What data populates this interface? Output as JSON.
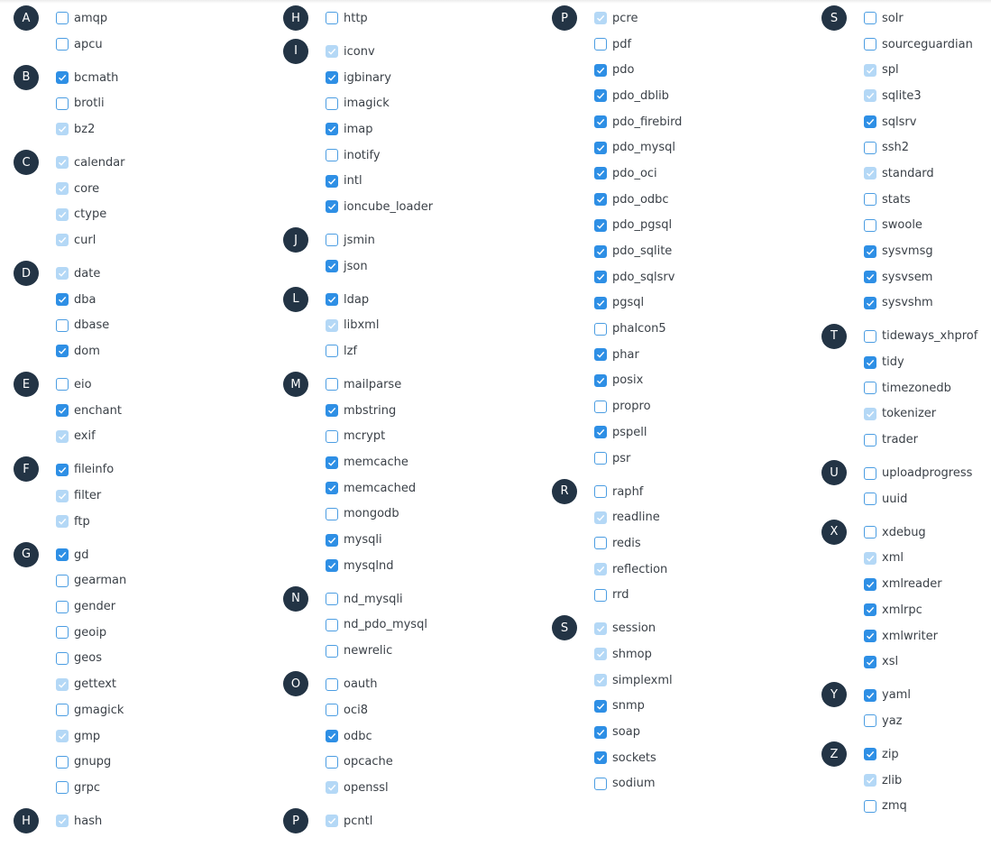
{
  "colors": {
    "badge": "#233445",
    "checked": "#2e8fe5",
    "disabled_checked": "#b4d8f6",
    "unchecked_border": "#4b9de2"
  },
  "state_legend": {
    "0": "unchecked",
    "1": "checked",
    "2": "checked-disabled"
  },
  "columns": [
    [
      {
        "letter": "A",
        "items": [
          [
            "amqp",
            0
          ],
          [
            "apcu",
            0
          ]
        ]
      },
      {
        "letter": "B",
        "items": [
          [
            "bcmath",
            1
          ],
          [
            "brotli",
            0
          ],
          [
            "bz2",
            2
          ]
        ]
      },
      {
        "letter": "C",
        "items": [
          [
            "calendar",
            2
          ],
          [
            "core",
            2
          ],
          [
            "ctype",
            2
          ],
          [
            "curl",
            2
          ]
        ]
      },
      {
        "letter": "D",
        "items": [
          [
            "date",
            2
          ],
          [
            "dba",
            1
          ],
          [
            "dbase",
            0
          ],
          [
            "dom",
            1
          ]
        ]
      },
      {
        "letter": "E",
        "items": [
          [
            "eio",
            0
          ],
          [
            "enchant",
            1
          ],
          [
            "exif",
            2
          ]
        ]
      },
      {
        "letter": "F",
        "items": [
          [
            "fileinfo",
            1
          ],
          [
            "filter",
            2
          ],
          [
            "ftp",
            2
          ]
        ]
      },
      {
        "letter": "G",
        "items": [
          [
            "gd",
            1
          ],
          [
            "gearman",
            0
          ],
          [
            "gender",
            0
          ],
          [
            "geoip",
            0
          ],
          [
            "geos",
            0
          ],
          [
            "gettext",
            2
          ],
          [
            "gmagick",
            0
          ],
          [
            "gmp",
            2
          ],
          [
            "gnupg",
            0
          ],
          [
            "grpc",
            0
          ]
        ]
      },
      {
        "letter": "H",
        "items": [
          [
            "hash",
            2
          ]
        ]
      }
    ],
    [
      {
        "letter": "H",
        "items": [
          [
            "http",
            0
          ]
        ]
      },
      {
        "letter": "I",
        "items": [
          [
            "iconv",
            2
          ],
          [
            "igbinary",
            1
          ],
          [
            "imagick",
            0
          ],
          [
            "imap",
            1
          ],
          [
            "inotify",
            0
          ],
          [
            "intl",
            1
          ],
          [
            "ioncube_loader",
            1
          ]
        ]
      },
      {
        "letter": "J",
        "items": [
          [
            "jsmin",
            0
          ],
          [
            "json",
            1
          ]
        ]
      },
      {
        "letter": "L",
        "items": [
          [
            "ldap",
            1
          ],
          [
            "libxml",
            2
          ],
          [
            "lzf",
            0
          ]
        ]
      },
      {
        "letter": "M",
        "items": [
          [
            "mailparse",
            0
          ],
          [
            "mbstring",
            1
          ],
          [
            "mcrypt",
            0
          ],
          [
            "memcache",
            1
          ],
          [
            "memcached",
            1
          ],
          [
            "mongodb",
            0
          ],
          [
            "mysqli",
            1
          ],
          [
            "mysqlnd",
            1
          ]
        ]
      },
      {
        "letter": "N",
        "items": [
          [
            "nd_mysqli",
            0
          ],
          [
            "nd_pdo_mysql",
            0
          ],
          [
            "newrelic",
            0
          ]
        ]
      },
      {
        "letter": "O",
        "items": [
          [
            "oauth",
            0
          ],
          [
            "oci8",
            0
          ],
          [
            "odbc",
            1
          ],
          [
            "opcache",
            0
          ],
          [
            "openssl",
            2
          ]
        ]
      },
      {
        "letter": "P",
        "items": [
          [
            "pcntl",
            2
          ]
        ]
      }
    ],
    [
      {
        "letter": "P",
        "items": [
          [
            "pcre",
            2
          ],
          [
            "pdf",
            0
          ],
          [
            "pdo",
            1
          ],
          [
            "pdo_dblib",
            1
          ],
          [
            "pdo_firebird",
            1
          ],
          [
            "pdo_mysql",
            1
          ],
          [
            "pdo_oci",
            1
          ],
          [
            "pdo_odbc",
            1
          ],
          [
            "pdo_pgsql",
            1
          ],
          [
            "pdo_sqlite",
            1
          ],
          [
            "pdo_sqlsrv",
            1
          ],
          [
            "pgsql",
            1
          ],
          [
            "phalcon5",
            0
          ],
          [
            "phar",
            1
          ],
          [
            "posix",
            1
          ],
          [
            "propro",
            0
          ],
          [
            "pspell",
            1
          ],
          [
            "psr",
            0
          ]
        ]
      },
      {
        "letter": "R",
        "items": [
          [
            "raphf",
            0
          ],
          [
            "readline",
            2
          ],
          [
            "redis",
            0
          ],
          [
            "reflection",
            2
          ],
          [
            "rrd",
            0
          ]
        ]
      },
      {
        "letter": "S",
        "items": [
          [
            "session",
            2
          ],
          [
            "shmop",
            2
          ],
          [
            "simplexml",
            2
          ],
          [
            "snmp",
            1
          ],
          [
            "soap",
            1
          ],
          [
            "sockets",
            1
          ],
          [
            "sodium",
            0
          ]
        ]
      }
    ],
    [
      {
        "letter": "S",
        "items": [
          [
            "solr",
            0
          ],
          [
            "sourceguardian",
            0
          ],
          [
            "spl",
            2
          ],
          [
            "sqlite3",
            2
          ],
          [
            "sqlsrv",
            1
          ],
          [
            "ssh2",
            0
          ],
          [
            "standard",
            2
          ],
          [
            "stats",
            0
          ],
          [
            "swoole",
            0
          ],
          [
            "sysvmsg",
            1
          ],
          [
            "sysvsem",
            1
          ],
          [
            "sysvshm",
            1
          ]
        ]
      },
      {
        "letter": "T",
        "items": [
          [
            "tideways_xhprof",
            0
          ],
          [
            "tidy",
            1
          ],
          [
            "timezonedb",
            0
          ],
          [
            "tokenizer",
            2
          ],
          [
            "trader",
            0
          ]
        ]
      },
      {
        "letter": "U",
        "items": [
          [
            "uploadprogress",
            0
          ],
          [
            "uuid",
            0
          ]
        ]
      },
      {
        "letter": "X",
        "items": [
          [
            "xdebug",
            0
          ],
          [
            "xml",
            2
          ],
          [
            "xmlreader",
            1
          ],
          [
            "xmlrpc",
            1
          ],
          [
            "xmlwriter",
            1
          ],
          [
            "xsl",
            1
          ]
        ]
      },
      {
        "letter": "Y",
        "items": [
          [
            "yaml",
            1
          ],
          [
            "yaz",
            0
          ]
        ]
      },
      {
        "letter": "Z",
        "items": [
          [
            "zip",
            1
          ],
          [
            "zlib",
            2
          ],
          [
            "zmq",
            0
          ]
        ]
      }
    ]
  ]
}
